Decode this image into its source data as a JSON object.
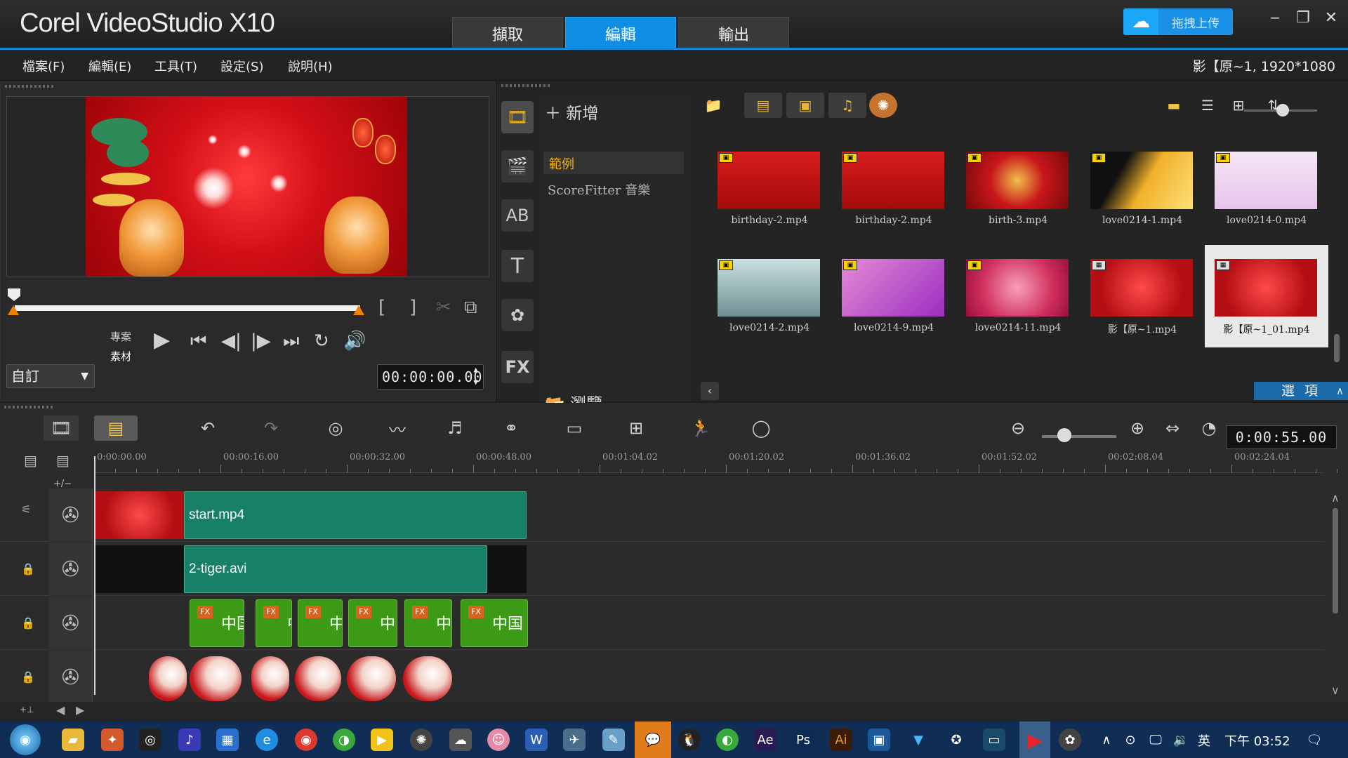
{
  "app": {
    "title": "Corel VideoStudio X10",
    "tabs": [
      "擷取",
      "編輯",
      "輸出"
    ],
    "active_tab": "編輯",
    "cloud_button": "拖拽上传",
    "accent_color": "#0f8fe4"
  },
  "menu": {
    "items": [
      "檔案(F)",
      "編輯(E)",
      "工具(T)",
      "設定(S)",
      "說明(H)"
    ],
    "project_info": "影【原~1, 1920*1080"
  },
  "preview": {
    "mode_project": "專案",
    "mode_clip": "素材",
    "dropdown": "自訂",
    "timecode": "00:00:00.00",
    "bracket_in": "[",
    "bracket_out": "]"
  },
  "library": {
    "add_label": "新增",
    "categories": [
      "範例",
      "ScoreFitter 音樂"
    ],
    "selected_category": "範例",
    "browse_label": "瀏覽",
    "options_label": "選 項",
    "items": [
      {
        "name": "birthday-2.mp4",
        "kind": "video"
      },
      {
        "name": "birthday-2.mp4",
        "kind": "video"
      },
      {
        "name": "birth-3.mp4",
        "kind": "video"
      },
      {
        "name": "love0214-1.mp4",
        "kind": "video"
      },
      {
        "name": "love0214-0.mp4",
        "kind": "video"
      },
      {
        "name": "love0214-2.mp4",
        "kind": "video"
      },
      {
        "name": "love0214-9.mp4",
        "kind": "video"
      },
      {
        "name": "love0214-11.mp4",
        "kind": "video"
      },
      {
        "name": "影【原~1.mp4",
        "kind": "film"
      },
      {
        "name": "影【原~1_01.mp4",
        "kind": "film",
        "selected": true
      }
    ]
  },
  "timeline": {
    "timecode": "0:00:55.00",
    "ruler": [
      "0:00:00.00",
      "00:00:16.00",
      "00:00:32.00",
      "00:00:48.00",
      "00:01:04.02",
      "00:01:20.02",
      "00:01:36.02",
      "00:01:52.02",
      "00:02:08.04",
      "00:02:24.04"
    ],
    "tracks": {
      "video": {
        "clip_label": "start.mp4"
      },
      "overlay1": {
        "clip_label": "2-tiger.avi"
      },
      "overlay2": {
        "fx_badge": "FX",
        "clips": [
          "中国",
          "中",
          "中",
          "中",
          "中",
          "中国"
        ]
      }
    },
    "add_track_label": "+/−"
  },
  "taskbar": {
    "lang": "英",
    "time": "下午 03:52"
  }
}
